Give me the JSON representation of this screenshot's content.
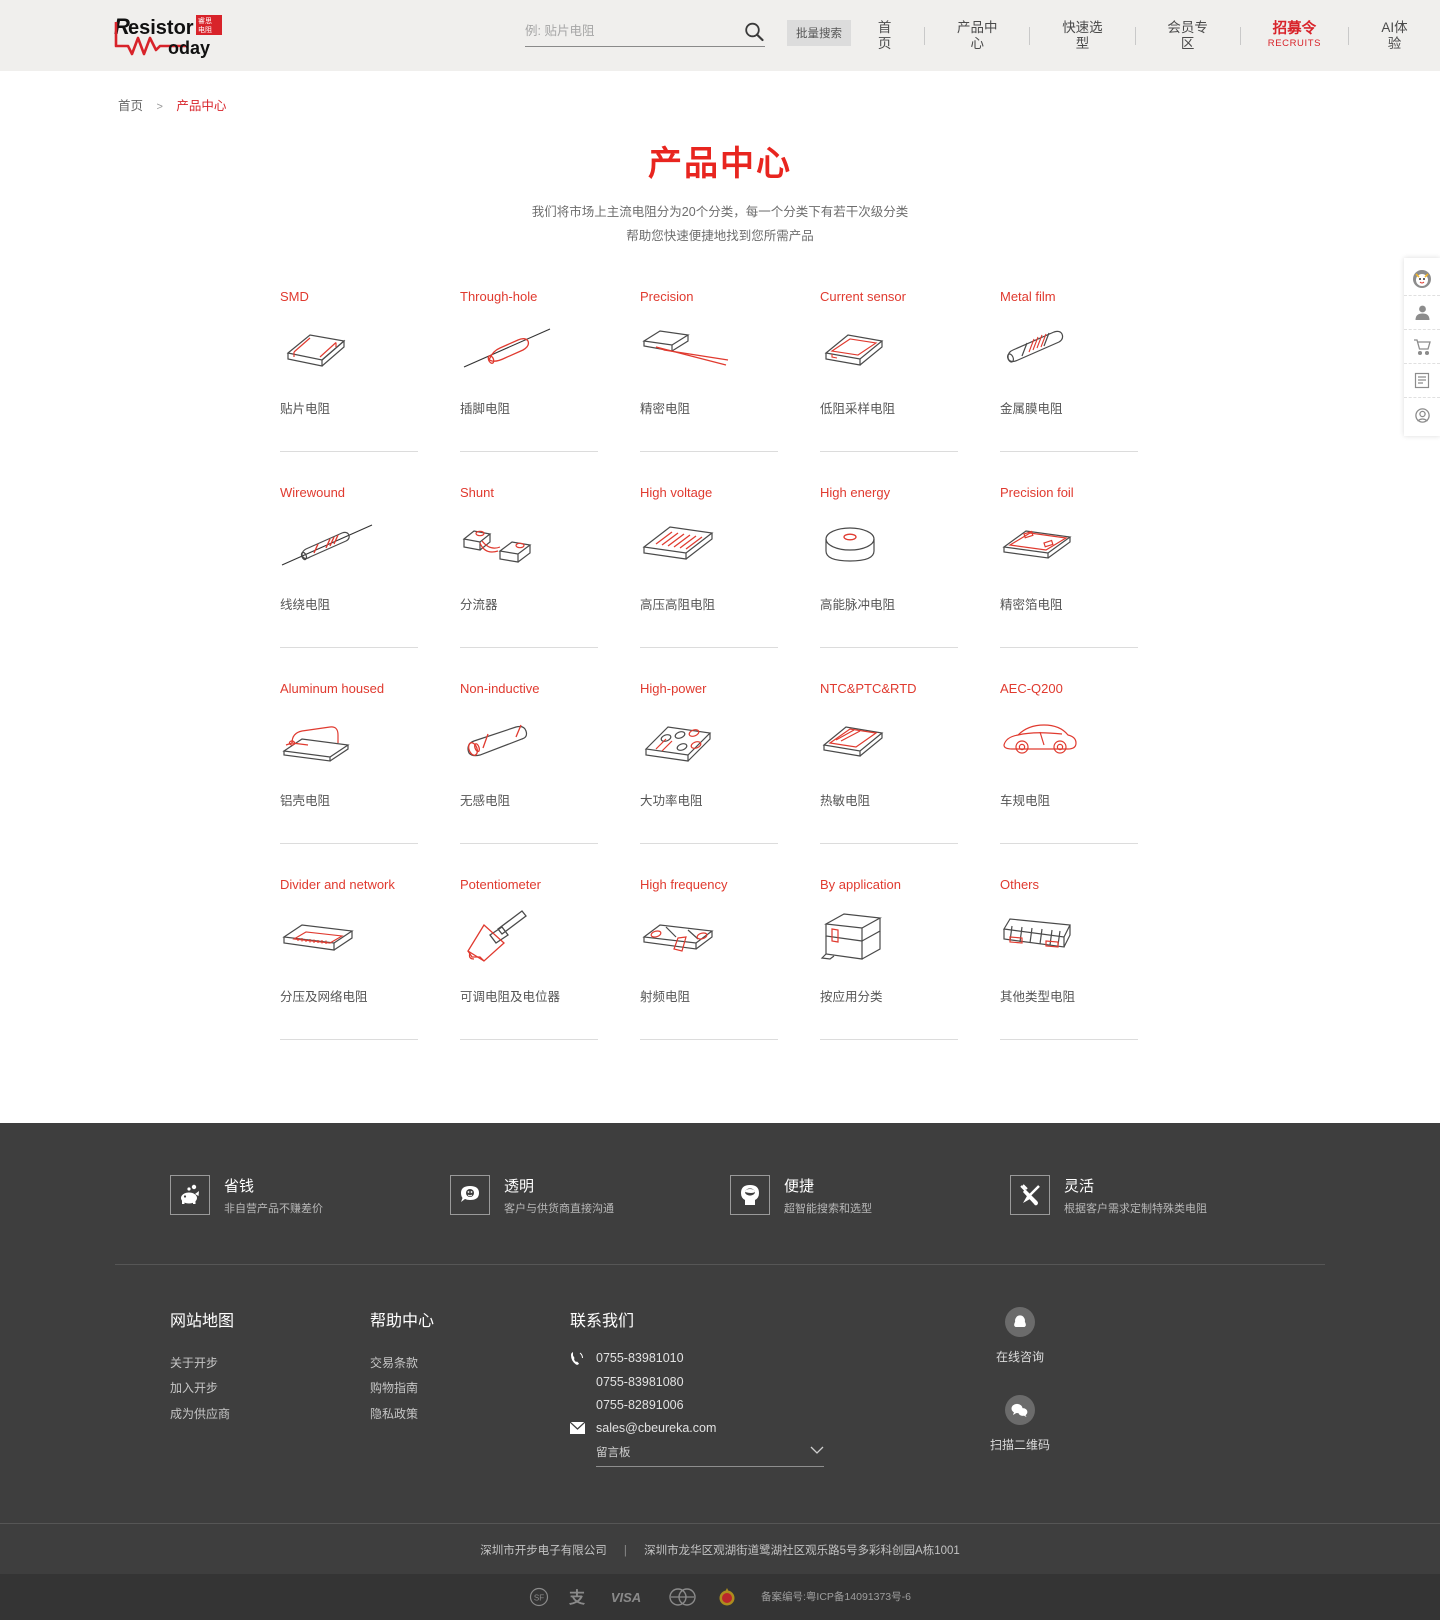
{
  "header": {
    "logo": {
      "brand": "Resistor",
      "brand2": "today",
      "badge": "睿思电阻"
    },
    "search": {
      "placeholder": "例: 贴片电阻",
      "value": "",
      "batch_label": "批量搜索",
      "icon": "search-icon"
    },
    "nav": [
      {
        "label": "首页",
        "sub": "",
        "highlight": false
      },
      {
        "label": "产品中心",
        "sub": "",
        "highlight": false
      },
      {
        "label": "快速选型",
        "sub": "",
        "highlight": false
      },
      {
        "label": "会员专区",
        "sub": "",
        "highlight": false
      },
      {
        "label": "招募令",
        "sub": "RECRUITS",
        "highlight": true
      },
      {
        "label": "AI体验",
        "sub": "",
        "highlight": false
      }
    ]
  },
  "breadcrumb": {
    "home": "首页",
    "sep": ">",
    "current": "产品中心"
  },
  "page": {
    "title": "产品中心",
    "subtitle_line1": "我们将市场上主流电阻分为20个分类，每一个分类下有若干次级分类",
    "subtitle_line2": "帮助您快速便捷地找到您所需产品"
  },
  "products": [
    {
      "title": "SMD",
      "label": "贴片电阻",
      "icon": "smd-chip-icon"
    },
    {
      "title": "Through-hole",
      "label": "插脚电阻",
      "icon": "axial-resistor-icon"
    },
    {
      "title": "Precision",
      "label": "精密电阻",
      "icon": "precision-chip-icon"
    },
    {
      "title": "Current sensor",
      "label": "低阻采样电阻",
      "icon": "current-sense-icon"
    },
    {
      "title": "Metal film",
      "label": "金属膜电阻",
      "icon": "metal-film-icon"
    },
    {
      "title": "Wirewound",
      "label": "线绕电阻",
      "icon": "wirewound-icon"
    },
    {
      "title": "Shunt",
      "label": "分流器",
      "icon": "shunt-icon"
    },
    {
      "title": "High voltage",
      "label": "高压高阻电阻",
      "icon": "high-voltage-icon"
    },
    {
      "title": "High energy",
      "label": "高能脉冲电阻",
      "icon": "high-energy-disc-icon"
    },
    {
      "title": "Precision foil",
      "label": "精密箔电阻",
      "icon": "precision-foil-icon"
    },
    {
      "title": "Aluminum housed",
      "label": "铝壳电阻",
      "icon": "aluminum-housed-icon"
    },
    {
      "title": "Non-inductive",
      "label": "无感电阻",
      "icon": "non-inductive-icon"
    },
    {
      "title": "High-power",
      "label": "大功率电阻",
      "icon": "high-power-icon"
    },
    {
      "title": "NTC&PTC&RTD",
      "label": "热敏电阻",
      "icon": "thermistor-icon"
    },
    {
      "title": "AEC-Q200",
      "label": "车规电阻",
      "icon": "car-icon"
    },
    {
      "title": "Divider and network",
      "label": "分压及网络电阻",
      "icon": "network-array-icon"
    },
    {
      "title": "Potentiometer",
      "label": "可调电阻及电位器",
      "icon": "potentiometer-icon"
    },
    {
      "title": "High frequency",
      "label": "射频电阻",
      "icon": "rf-resistor-icon"
    },
    {
      "title": "By application",
      "label": "按应用分类",
      "icon": "application-box-icon"
    },
    {
      "title": "Others",
      "label": "其他类型电阻",
      "icon": "others-grid-icon"
    }
  ],
  "side_tools": [
    {
      "name": "mascot-icon"
    },
    {
      "name": "user-icon"
    },
    {
      "name": "cart-icon"
    },
    {
      "name": "list-icon"
    },
    {
      "name": "service-icon"
    }
  ],
  "footer": {
    "features": [
      {
        "title": "省钱",
        "desc": "非自营产品不赚差价",
        "icon": "piggy-bank-icon"
      },
      {
        "title": "透明",
        "desc": "客户与供货商直接沟通",
        "icon": "chat-bubble-icon"
      },
      {
        "title": "便捷",
        "desc": "超智能搜索和选型",
        "icon": "head-brain-icon"
      },
      {
        "title": "灵活",
        "desc": "根据客户需求定制特殊类电阻",
        "icon": "tools-icon"
      }
    ],
    "sitemap": {
      "heading": "网站地图",
      "links": [
        "关于开步",
        "加入开步",
        "成为供应商"
      ]
    },
    "help": {
      "heading": "帮助中心",
      "links": [
        "交易条款",
        "购物指南",
        "隐私政策"
      ]
    },
    "contact": {
      "heading": "联系我们",
      "phones": [
        "0755-83981010",
        "0755-83981080",
        "0755-82891006"
      ],
      "email": "sales@cbeureka.com",
      "select_value": "留言板",
      "phone_icon": "phone-icon",
      "mail_icon": "mail-icon",
      "chevron_icon": "chevron-down-icon"
    },
    "qr": [
      {
        "label": "在线咨询",
        "icon": "qq-icon"
      },
      {
        "label": "扫描二维码",
        "icon": "wechat-icon"
      }
    ],
    "company": "深圳市开步电子有限公司",
    "address": "深圳市龙华区观湖街道鹭湖社区观乐路5号多彩科创园A栋1001",
    "pay_icons": [
      "sf-icon",
      "alipay-icon",
      "visa-icon",
      "mastercard-icon",
      "police-badge-icon"
    ],
    "icp": "备案编号:粤ICP备14091373号-6"
  },
  "colors": {
    "accent": "#e03a2f",
    "brand_red": "#d8232a",
    "header_bg": "#f0efed",
    "footer_bg": "#3e3e3e"
  }
}
